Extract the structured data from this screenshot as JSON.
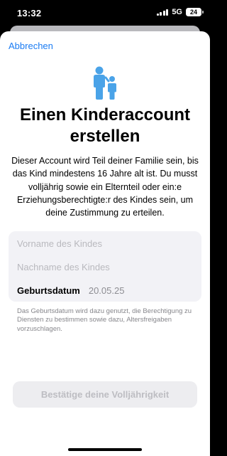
{
  "status_bar": {
    "time": "13:32",
    "network": "5G",
    "battery": "24",
    "signal_bars": 4
  },
  "navigation": {
    "cancel_label": "Abbrechen"
  },
  "header": {
    "icon": "family-parent-child-icon",
    "title": "Einen Kinderaccount erstellen",
    "description": "Dieser Account wird Teil deiner Familie sein, bis das Kind mindestens 16 Jahre alt ist. Du musst volljährig sowie ein Elternteil oder ein:e Erziehungsberechtigte:r des Kindes sein, um deine Zustimmung zu erteilen."
  },
  "form": {
    "first_name_placeholder": "Vorname des Kindes",
    "last_name_placeholder": "Nachname des Kindes",
    "birthdate_label": "Geburtsdatum",
    "birthdate_value": "20.05.25"
  },
  "info_note": "Das Geburtsdatum wird dazu genutzt, die Berechtigung zu Diensten zu bestimmen sowie dazu, Altersfreigaben vorzuschlagen.",
  "confirm_button": {
    "label": "Bestätige deine Volljährigkeit",
    "enabled": false
  },
  "colors": {
    "accent": "#1b7cf3",
    "icon_blue": "#4aa3e8",
    "sheet_background": "#ffffff",
    "field_background": "#f2f2f6"
  }
}
